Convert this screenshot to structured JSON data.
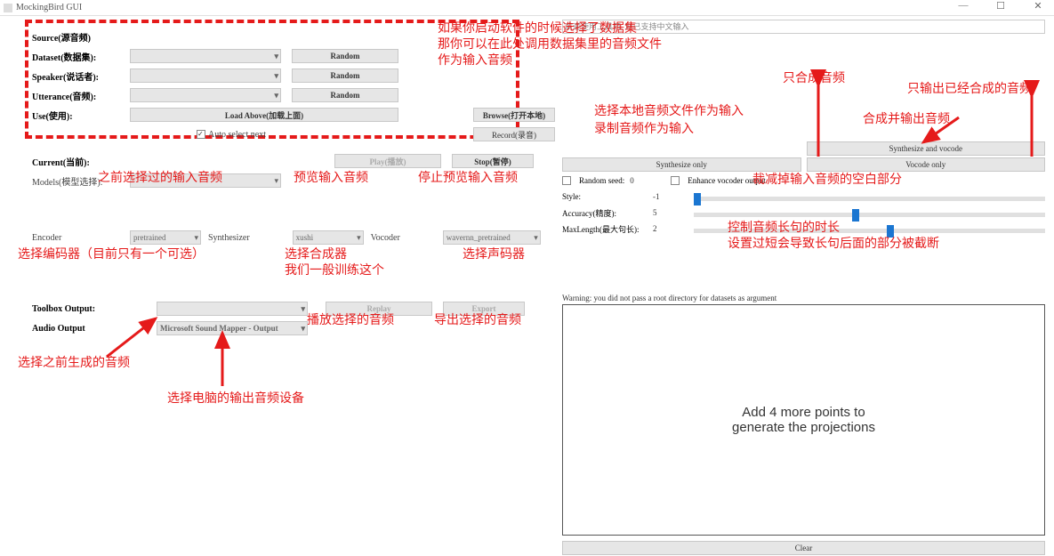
{
  "title": "MockingBird GUI",
  "window_buttons": {
    "min": "—",
    "max": "☐",
    "close": "✕"
  },
  "source": {
    "heading": "Source(源音频)",
    "dataset_label": "Dataset(数据集):",
    "speaker_label": "Speaker(说话者):",
    "utterance_label": "Utterance(音频):",
    "use_label": "Use(使用):",
    "random_btn": "Random",
    "load_above": "Load Above(加载上面)",
    "browse": "Browse(打开本地)",
    "record": "Record(录音)",
    "auto_select": "Auto select next"
  },
  "current": {
    "heading": "Current(当前):",
    "models_label": "Models(模型选择):",
    "play_btn": "Play(播放)",
    "stop_btn": "Stop(暂停)"
  },
  "models": {
    "encoder_label": "Encoder",
    "encoder_value": "pretrained",
    "synth_label": "Synthesizer",
    "synth_value": "xushi",
    "vocoder_label": "Vocoder",
    "vocoder_value": "wavernn_pretrained"
  },
  "output": {
    "toolbox_label": "Toolbox Output:",
    "audio_label": "Audio Output",
    "audio_value": "Microsoft Sound Mapper - Output",
    "replay": "Replay",
    "export": "Export"
  },
  "right": {
    "top_input_hint": "欢迎使用工具箱, 现已支持中文输入",
    "syn_and_voc": "Synthesize and vocode",
    "syn_only": "Synthesize only",
    "voc_only": "Vocode only",
    "random_seed_label": "Random seed:",
    "random_seed_value": "0",
    "enhance_label": "Enhance vocoder output",
    "style_label": "Style:",
    "style_value": "-1",
    "accuracy_label": "Accuracy(精度):",
    "accuracy_value": "5",
    "maxlen_label": "MaxLength(最大句长):",
    "maxlen_value": "2",
    "warning": "Warning: you did not pass a root directory for datasets as argument",
    "plot_text": "Add 4 more points to\ngenerate the projections",
    "clear": "Clear"
  },
  "annotations": {
    "a1": "如果你启动软件的时候选择了数据集\n那你可以在此处调用数据集里的音频文件\n作为输入音频",
    "a2": "选择本地音频文件作为输入",
    "a3": "录制音频作为输入",
    "a4": "之前选择过的输入音频",
    "a5": "预览输入音频",
    "a6": "停止预览输入音频",
    "a7": "选择编码器（目前只有一个可选）",
    "a8": "选择合成器\n我们一般训练这个",
    "a9": "选择声码器",
    "a10": "播放选择的音频",
    "a11": "导出选择的音频",
    "a12": "选择之前生成的音频",
    "a13": "选择电脑的输出音频设备",
    "a14": "只合成音频",
    "a15": "只输出已经合成的音频",
    "a16": "合成并输出音频",
    "a17": "裁减掉输入音频的空白部分",
    "a18": "控制音频长句的时长\n设置过短会导致长句后面的部分被截断"
  }
}
